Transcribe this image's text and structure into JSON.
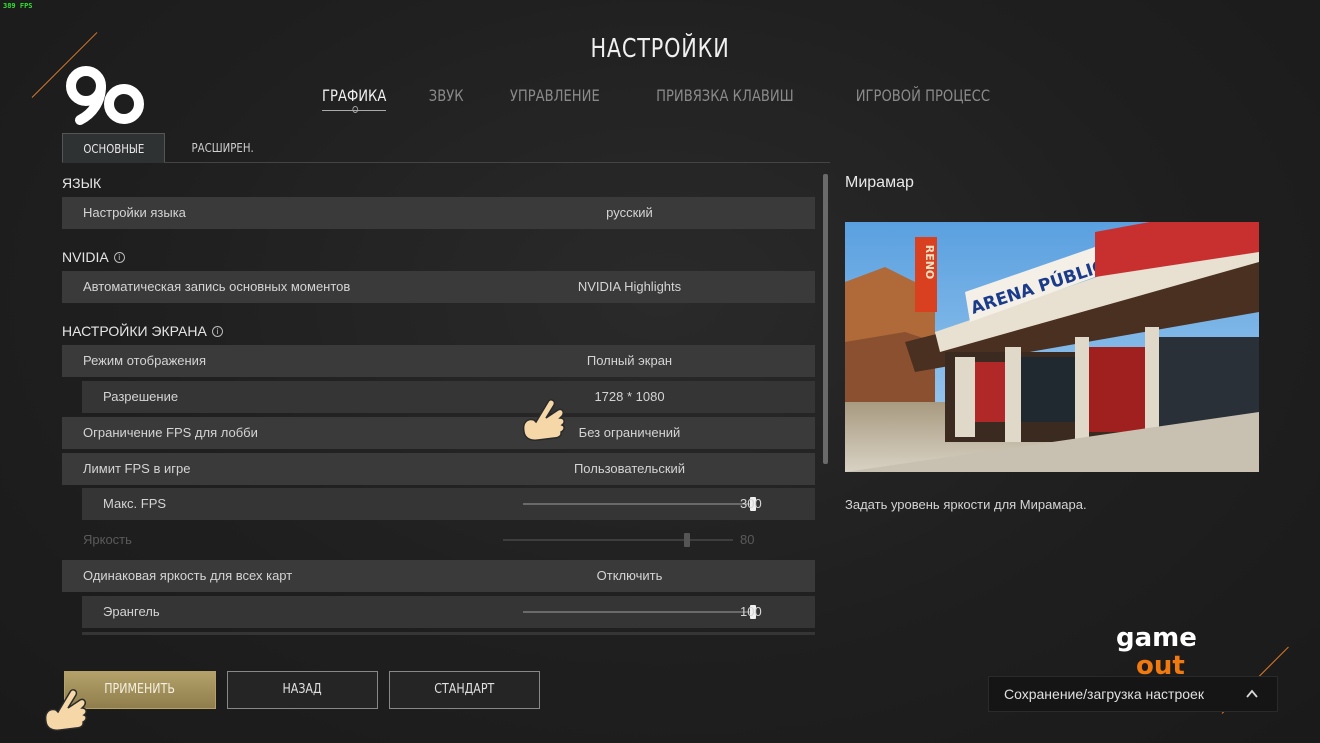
{
  "fps_counter": "389 FPS",
  "page": {
    "title": "НАСТРОЙКИ",
    "tabs": [
      {
        "label": "ГРАФИКА",
        "active": true
      },
      {
        "label": "ЗВУК",
        "active": false
      },
      {
        "label": "УПРАВЛЕНИЕ",
        "active": false
      },
      {
        "label": "ПРИВЯЗКА КЛАВИШ",
        "active": false
      },
      {
        "label": "ИГРОВОЙ ПРОЦЕСС",
        "active": false
      }
    ],
    "subtabs": [
      {
        "label": "ОСНОВНЫЕ",
        "active": true
      },
      {
        "label": "РАСШИРЕН.",
        "active": false
      }
    ]
  },
  "sections": {
    "language": {
      "title": "ЯЗЫК"
    },
    "nvidia": {
      "title": "NVIDIA"
    },
    "screen": {
      "title": "НАСТРОЙКИ ЭКРАНА"
    }
  },
  "rows": {
    "language_setting": {
      "label": "Настройки языка",
      "value": "русский"
    },
    "nvidia_highlights": {
      "label": "Автоматическая запись основных моментов",
      "value": "NVIDIA Highlights"
    },
    "display_mode": {
      "label": "Режим отображения",
      "value": "Полный экран"
    },
    "resolution": {
      "label": "Разрешение",
      "value": "1728 * 1080"
    },
    "lobby_fps": {
      "label": "Ограничение FPS для лобби",
      "value": "Без ограничений"
    },
    "ingame_fps": {
      "label": "Лимит FPS в игре",
      "value": "Пользовательский"
    },
    "max_fps": {
      "label": "Макс. FPS",
      "value": "300",
      "fraction": 1.0
    },
    "brightness": {
      "label": "Яркость",
      "value": "80",
      "fraction": 0.8,
      "disabled": true
    },
    "same_brightness": {
      "label": "Одинаковая яркость для всех карт",
      "value": "Отключить"
    },
    "erangel": {
      "label": "Эрангель",
      "value": "100",
      "fraction": 1.0
    }
  },
  "preview": {
    "title": "Мирамар",
    "image_sign": "ARENA PÚBLICA",
    "image_side_sign": "RENO",
    "description": "Задать уровень яркости для Мирамара."
  },
  "buttons": {
    "apply": "ПРИМЕНИТЬ",
    "back": "НАЗАД",
    "default": "СТАНДАРТ"
  },
  "save_load": {
    "label": "Сохранение/загрузка настроек",
    "icon": "chevron-up-icon"
  },
  "watermark": {
    "top": "game",
    "bottom": "out"
  },
  "colors": {
    "accent": "#b4a16a",
    "watermark_orange": "#f07a10",
    "corner_line": "#d8782a"
  }
}
